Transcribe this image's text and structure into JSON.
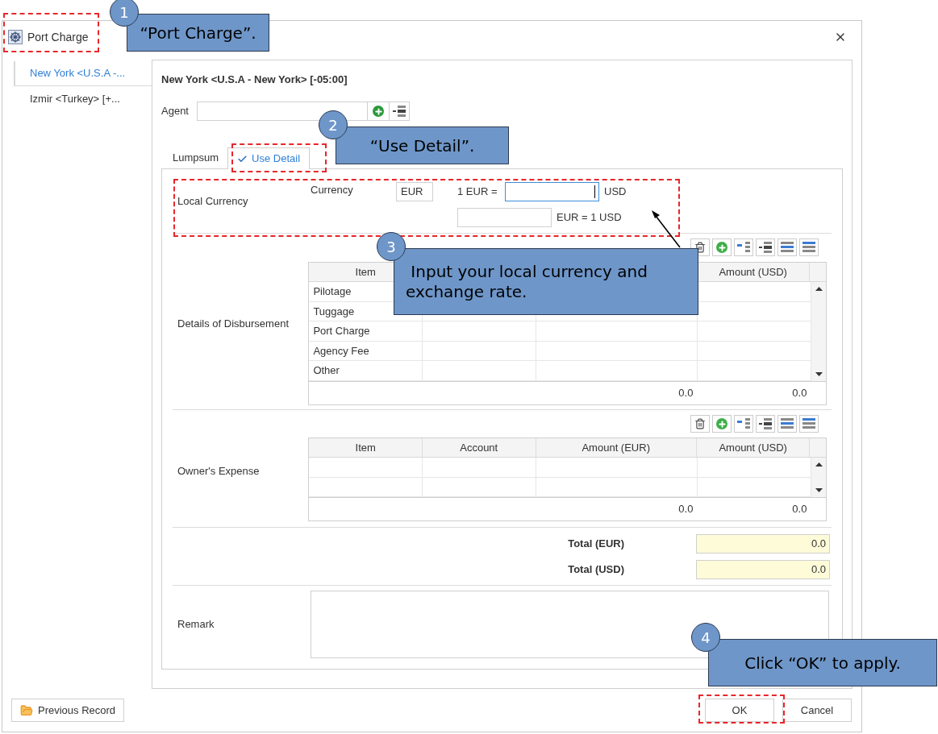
{
  "window": {
    "title": "Port Charge"
  },
  "sidebar": {
    "items": [
      {
        "label": "New York <U.S.A -...",
        "selected": true
      },
      {
        "label": "Izmir <Turkey> [+...",
        "selected": false
      }
    ]
  },
  "port_heading": "New York <U.S.A - New York> [-05:00]",
  "agent": {
    "label": "Agent"
  },
  "tabs": [
    {
      "label": "Lumpsum",
      "selected": false
    },
    {
      "label": "Use Detail",
      "selected": true
    }
  ],
  "local_currency": {
    "label": "Local Currency",
    "currency_label": "Currency",
    "currency_value": "EUR",
    "rate_prefix": "1 EUR =",
    "rate_suffix": "USD",
    "rate_focused": true,
    "inverse_suffix": "EUR = 1 USD"
  },
  "disbursement": {
    "label": "Details of Disbursement",
    "headers": {
      "column_1": "Item",
      "column_4": "Amount (USD)"
    },
    "rows": [
      "Pilotage",
      "Tuggage",
      "Port Charge",
      "Agency Fee",
      "Other"
    ],
    "footer": [
      "0.0",
      "0.0"
    ]
  },
  "owners_expense": {
    "label": "Owner's Expense",
    "headers": {
      "column_1": "Item",
      "column_2": "Account",
      "column_3": "Amount (EUR)",
      "column_4": "Amount (USD)"
    },
    "footer": [
      "0.0",
      "0.0"
    ]
  },
  "totals": [
    {
      "label": "Total (EUR)",
      "value": "0.0"
    },
    {
      "label": "Total (USD)",
      "value": "0.0"
    }
  ],
  "remark": {
    "label": "Remark"
  },
  "buttons": {
    "previous": "Previous Record",
    "ok": "OK",
    "cancel": "Cancel"
  },
  "callouts": [
    {
      "number": "1",
      "text": "“Port Charge”."
    },
    {
      "number": "2",
      "text": "“Use Detail”."
    },
    {
      "number": "3",
      "text": " Input your local currency and exchange rate."
    },
    {
      "number": "4",
      "text": "Click “OK” to apply."
    }
  ]
}
